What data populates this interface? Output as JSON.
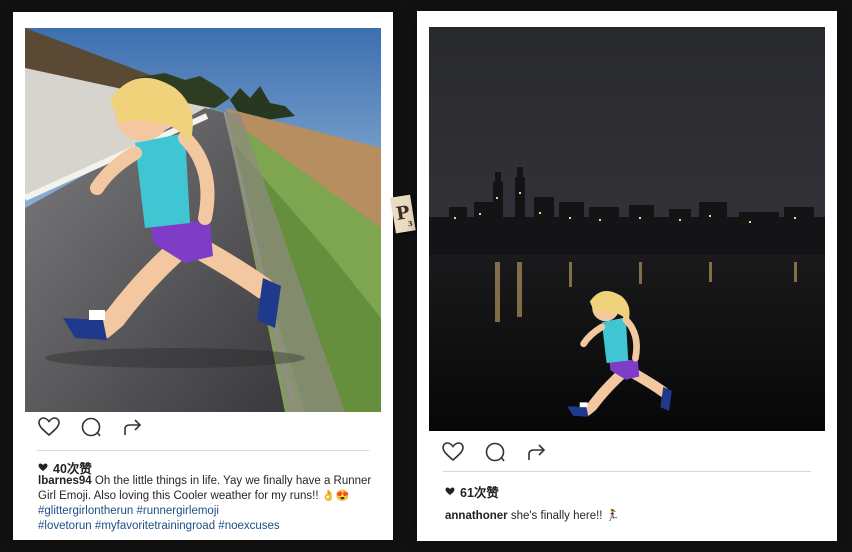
{
  "posts": [
    {
      "likes": "40次赞",
      "username": "lbarnes94",
      "caption_text": " Oh the little things in life. Yay we finally have a Runner Girl Emoji. Also loving this Cooler weather for my runs!! ",
      "caption_emojis": "👌😍",
      "hashtags": [
        "#glittergirlontherun",
        "#runnergirlemoji",
        "#lovetorun",
        "#myfavoritetrainingroad",
        "#noexcuses"
      ]
    },
    {
      "likes": "61次赞",
      "username": "annathoner",
      "caption_text": " she's finally here!! ",
      "caption_emojis": "🏃‍♀️"
    }
  ],
  "scrabble_tile": {
    "letter": "P",
    "points": "3"
  },
  "icons": [
    "heart-icon",
    "comment-icon",
    "share-icon",
    "small-heart-icon"
  ],
  "colors": {
    "background": "#111111",
    "card": "#ffffff",
    "hashtag": "#1d4e86",
    "text": "#262626"
  }
}
